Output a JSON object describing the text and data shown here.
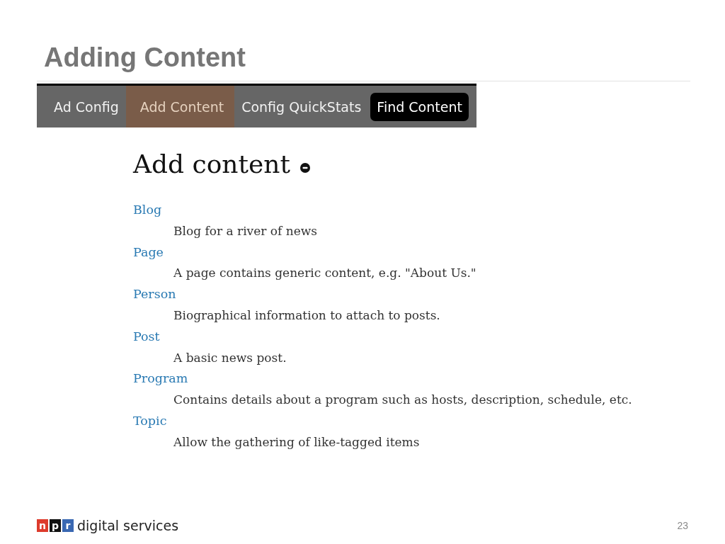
{
  "slide": {
    "title": "Adding Content"
  },
  "toolbar": {
    "tabs": [
      {
        "label": "Ad Config",
        "selected": false,
        "highlighted": false
      },
      {
        "label": "Add Content",
        "selected": true,
        "highlighted": false
      },
      {
        "label": "Config QuickStats",
        "selected": false,
        "highlighted": false
      },
      {
        "label": "Find Content",
        "selected": false,
        "highlighted": true
      }
    ]
  },
  "content": {
    "heading": "Add content",
    "items": [
      {
        "name": "Blog",
        "description": "Blog for a river of news"
      },
      {
        "name": "Page",
        "description": "A page contains generic content, e.g. \"About Us.\""
      },
      {
        "name": "Person",
        "description": "Biographical information to attach to posts."
      },
      {
        "name": "Post",
        "description": "A basic news post."
      },
      {
        "name": "Program",
        "description": "Contains details about a program such as hosts, description, schedule, etc."
      },
      {
        "name": "Topic",
        "description": "Allow the gathering of like-tagged items"
      }
    ]
  },
  "footer": {
    "logo": [
      {
        "letter": "n",
        "color": "#dd3b2c"
      },
      {
        "letter": "p",
        "color": "#111111"
      },
      {
        "letter": "r",
        "color": "#3a68b2"
      }
    ],
    "brand": "digital services",
    "page_number": "23"
  }
}
